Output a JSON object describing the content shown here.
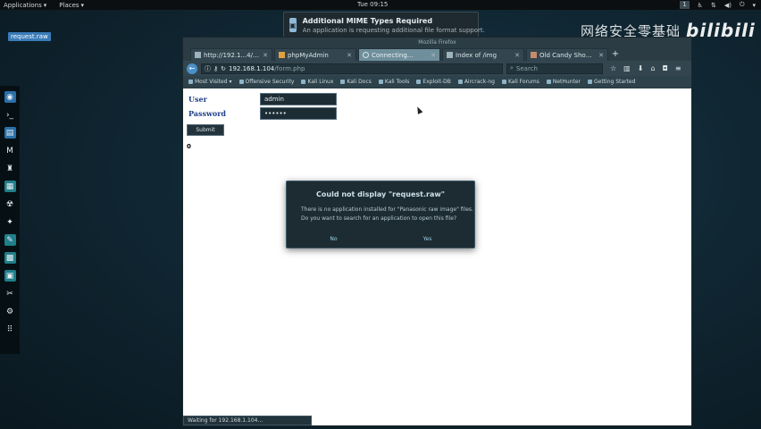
{
  "panel": {
    "applications": "Applications",
    "places": "Places",
    "clock": "Tue 09:15",
    "workspace": "1"
  },
  "watermark": {
    "text": "网络安全零基础",
    "logo": "bilibili"
  },
  "desktop": {
    "file": "request.raw"
  },
  "notification": {
    "title": "Additional MIME Types Required",
    "subtitle": "An application is requesting additional file format support."
  },
  "firefox": {
    "window_title": "Mozilla Firefox",
    "tabs": [
      {
        "label": "http://192.1...4/index.html"
      },
      {
        "label": "phpMyAdmin"
      },
      {
        "label": "Connecting..."
      },
      {
        "label": "Index of /img"
      },
      {
        "label": "Old Candy Shop | Put..."
      }
    ],
    "url_host": "192.168.1.104",
    "url_path": "/form.php",
    "search_placeholder": "Search",
    "bookmarks": [
      "Most Visited",
      "Offensive Security",
      "Kali Linux",
      "Kali Docs",
      "Kali Tools",
      "Exploit-DB",
      "Aircrack-ng",
      "Kali Forums",
      "NetHunter",
      "Getting Started"
    ]
  },
  "page": {
    "user_label": "User",
    "user_value": "admin",
    "password_label": "Password",
    "password_value": "••••••",
    "submit_label": "Submit",
    "result_text": "0",
    "status": "Waiting for 192.168.1.104..."
  },
  "dialog": {
    "title": "Could not display \"request.raw\"",
    "line1": "There is no application installed for \"Panasonic raw image\" files.",
    "line2": "Do you want to search for an application to open this file?",
    "no_label": "No",
    "yes_label": "Yes"
  }
}
